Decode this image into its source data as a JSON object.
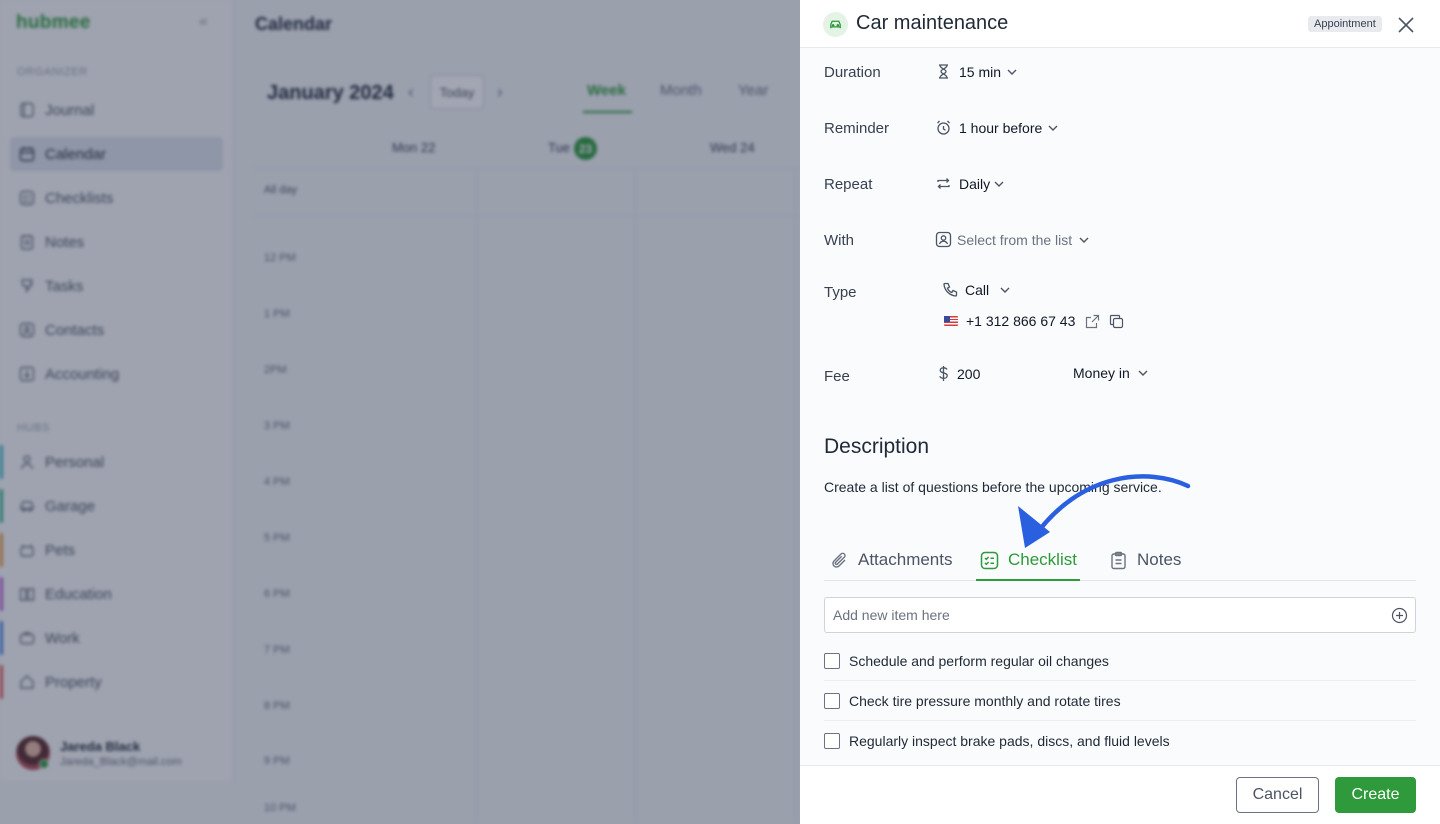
{
  "app": {
    "logo": "hubmee",
    "sections": {
      "organizer": "ORGANIZER",
      "hubs": "HUBS"
    },
    "nav": [
      {
        "label": "Journal",
        "icon": "journal-icon"
      },
      {
        "label": "Calendar",
        "icon": "calendar-icon",
        "active": true
      },
      {
        "label": "Checklists",
        "icon": "checklist-icon"
      },
      {
        "label": "Notes",
        "icon": "notes-icon"
      },
      {
        "label": "Tasks",
        "icon": "tasks-icon"
      },
      {
        "label": "Contacts",
        "icon": "contacts-icon"
      },
      {
        "label": "Accounting",
        "icon": "accounting-icon"
      }
    ],
    "hubs": [
      {
        "label": "Personal",
        "icon": "person-icon",
        "color": "#3fb6c9"
      },
      {
        "label": "Garage",
        "icon": "car-icon",
        "color": "#2fb08b"
      },
      {
        "label": "Pets",
        "icon": "pet-icon",
        "color": "#e59a3b"
      },
      {
        "label": "Education",
        "icon": "book-icon",
        "color": "#b35bd1"
      },
      {
        "label": "Work",
        "icon": "briefcase-icon",
        "color": "#3f7fe0"
      },
      {
        "label": "Property",
        "icon": "house-icon",
        "color": "#e05252"
      }
    ],
    "user": {
      "name": "Jareda Black",
      "email": "Jareda_Black@mail.com"
    }
  },
  "calendar": {
    "page_title": "Calendar",
    "month": "January 2024",
    "today": "Today",
    "views": [
      "Week",
      "Month",
      "Year"
    ],
    "days": [
      "Mon 22",
      "Tue",
      "Wed 24"
    ],
    "today_num": "23",
    "allday": "All day",
    "hours": [
      "12 PM",
      "1 PM",
      "2PM",
      "3 PM",
      "4 PM",
      "5 PM",
      "6 PM",
      "7 PM",
      "8 PM",
      "9 PM",
      "10 PM"
    ]
  },
  "panel": {
    "title": "Car maintenance",
    "tag": "Appointment",
    "duration": {
      "label": "Duration",
      "value": "15 min"
    },
    "reminder": {
      "label": "Reminder",
      "value": "1 hour before"
    },
    "repeat": {
      "label": "Repeat",
      "value": "Daily"
    },
    "with": {
      "label": "With",
      "value": "Select from the list"
    },
    "type": {
      "label": "Type",
      "value": "Call",
      "phone": "+1 312 866 67 43"
    },
    "fee": {
      "label": "Fee",
      "amount": "200",
      "direction": "Money in"
    },
    "description": {
      "title": "Description",
      "text": "Create a list of questions before the upcoming service."
    },
    "tabs": [
      {
        "label": "Attachments"
      },
      {
        "label": "Checklist",
        "active": true
      },
      {
        "label": "Notes"
      }
    ],
    "checklist": {
      "placeholder": "Add new item here",
      "items": [
        "Schedule and perform regular oil changes",
        "Check tire pressure monthly and rotate tires",
        "Regularly inspect brake pads, discs, and fluid levels"
      ]
    },
    "buttons": {
      "cancel": "Cancel",
      "create": "Create"
    }
  },
  "colors": {
    "accent": "#2e9a3b",
    "annotation_arrow": "#2a5fe0",
    "overlay": "#222a48"
  }
}
